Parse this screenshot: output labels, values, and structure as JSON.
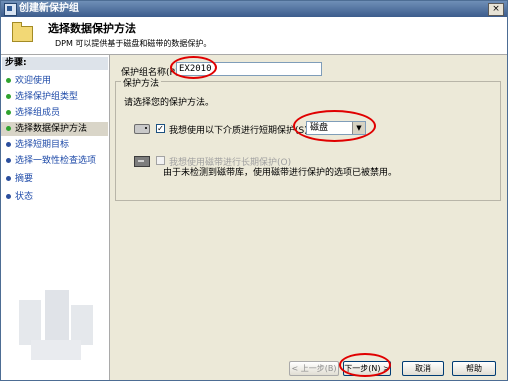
{
  "window": {
    "title": "创建新保护组",
    "close_label": "×"
  },
  "header": {
    "title": "选择数据保护方法",
    "subtitle": "DPM 可以提供基于磁盘和磁带的数据保护。"
  },
  "sidebar": {
    "heading": "步骤:",
    "items": [
      {
        "label": "欢迎使用",
        "state": "done"
      },
      {
        "label": "选择保护组类型",
        "state": "done"
      },
      {
        "label": "选择组成员",
        "state": "done"
      },
      {
        "label": "选择数据保护方法",
        "state": "current"
      },
      {
        "label": "选择短期目标",
        "state": "todo"
      },
      {
        "label": "选择一致性检查选项",
        "state": "todo"
      },
      {
        "label": "摘要",
        "state": "todo"
      },
      {
        "label": "状态",
        "state": "todo"
      }
    ]
  },
  "form": {
    "group_name_label": "保护组名称(P):",
    "group_name_value": "EX2010",
    "method_legend": "保护方法",
    "method_prompt": "请选择您的保护方法。",
    "short_term": {
      "label": "我想使用以下介质进行短期保护(S):",
      "checked": true,
      "media_value": "磁盘"
    },
    "long_term": {
      "label": "我想使用磁带进行长期保护(O)",
      "checked": false,
      "note": "由于未检测到磁带库，使用磁带进行保护的选项已被禁用。"
    }
  },
  "buttons": {
    "back": "< 上一步(B)",
    "next": "下一步(N) >",
    "cancel": "取消",
    "help": "帮助"
  },
  "colors": {
    "annotation": "#e00000",
    "title_bar": "#3c5c8c",
    "step_link": "#1e4aa8"
  }
}
